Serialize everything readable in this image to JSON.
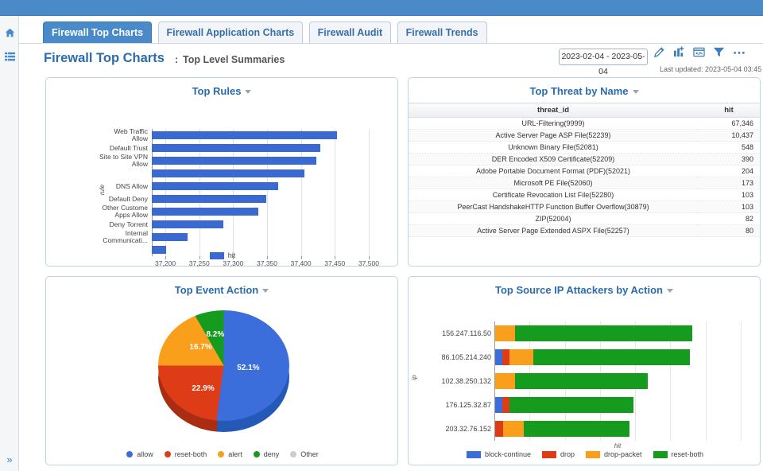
{
  "theme": {
    "band_blue": "#4a8ac9",
    "accent_blue": "#2b6cab",
    "bar_blue": "#3b69d4"
  },
  "rail": {
    "home_icon": "home-icon",
    "menu_icon": "list-menu-icon",
    "expand_icon": "double-chevron-right-icon"
  },
  "tabs": [
    {
      "label": "Firewall Top Charts",
      "active": true
    },
    {
      "label": "Firewall Application Charts",
      "active": false
    },
    {
      "label": "Firewall Audit",
      "active": false
    },
    {
      "label": "Firewall Trends",
      "active": false
    }
  ],
  "header": {
    "title": "Firewall Top Charts",
    "separator": ":",
    "subtitle": "Top Level Summaries",
    "date_range": "2023-02-04 - 2023-05-04",
    "last_updated": "Last updated: 2023-05-04 03:45",
    "refresh_icon": "refresh-icon",
    "tools": [
      {
        "name": "edit-pencil-icon",
        "label": "Edit"
      },
      {
        "name": "add-chart-icon",
        "label": "Add Chart"
      },
      {
        "name": "dashboard-widget-icon",
        "label": "Add Widget"
      },
      {
        "name": "filter-funnel-icon",
        "label": "Filter"
      },
      {
        "name": "more-options-icon",
        "label": "More"
      }
    ]
  },
  "panels": {
    "rules": {
      "title": "Top Rules",
      "caret": "chevron-down-icon"
    },
    "threat": {
      "title": "Top Threat by Name",
      "caret": "chevron-down-icon"
    },
    "event": {
      "title": "Top Event Action",
      "caret": "chevron-down-icon"
    },
    "source": {
      "title": "Top Source IP Attackers by Action",
      "caret": "chevron-down-icon"
    }
  },
  "threat_table": {
    "columns": [
      "threat_id",
      "hit"
    ],
    "rows": [
      [
        "URL-Filtering(9999)",
        "67,346"
      ],
      [
        "Active Server Page ASP File(52239)",
        "10,437"
      ],
      [
        "Unknown Binary File(52081)",
        "548"
      ],
      [
        "DER Encoded X509 Certificate(52209)",
        "390"
      ],
      [
        "Adobe Portable Document Format (PDF)(52021)",
        "204"
      ],
      [
        "Microsoft PE File(52060)",
        "173"
      ],
      [
        "Certificate Revocation List File(52280)",
        "103"
      ],
      [
        "PeerCast HandshakeHTTP Function Buffer Overflow(30879)",
        "103"
      ],
      [
        "ZIP(52004)",
        "82"
      ],
      [
        "Active Server Page Extended ASPX File(52257)",
        "80"
      ]
    ]
  },
  "chart_data": [
    {
      "id": "top_rules",
      "type": "bar",
      "orientation": "horizontal",
      "title": "Top Rules",
      "xlabel": "",
      "ylabel": "rule",
      "legend": [
        {
          "name": "hit",
          "color": "#3b69d4"
        }
      ],
      "legend_position": "bottom",
      "grid": true,
      "xlim": [
        37180,
        37520
      ],
      "xticks": [
        "37,200",
        "37,250",
        "37,300",
        "37,350",
        "37,400",
        "37,450",
        "37,500"
      ],
      "xtick_values": [
        37200,
        37250,
        37300,
        37350,
        37400,
        37450,
        37500
      ],
      "categories": [
        "Web Traffic Allow",
        "Default Trust",
        "Site to Site VPN Allow",
        "",
        "DNS Allow",
        "Default Deny",
        "Other Custome Apps Allow",
        "Deny Torrent",
        "Internal Communicati..."
      ],
      "values": [
        37453,
        37428,
        37423,
        37405,
        37366,
        37349,
        37337,
        37285,
        37233,
        37201
      ],
      "series": [
        {
          "name": "hit",
          "values": [
            37453,
            37428,
            37423,
            37405,
            37366,
            37349,
            37337,
            37285,
            37233,
            37201
          ]
        }
      ]
    },
    {
      "id": "top_event_action",
      "type": "pie",
      "title": "Top Event Action",
      "labels": [
        "allow",
        "reset-both",
        "alert",
        "deny",
        "Other"
      ],
      "values": [
        52.1,
        22.9,
        16.7,
        8.2,
        0
      ],
      "value_labels": [
        "52.1%",
        "22.9%",
        "16.7%",
        "8.2%",
        ""
      ],
      "colors": [
        "#3b6ddb",
        "#dd3c17",
        "#f99f1b",
        "#159b1e",
        "#cccccc"
      ],
      "legend_position": "bottom",
      "three_d": true
    },
    {
      "id": "top_source_ip_attackers",
      "type": "bar",
      "subtype": "stacked",
      "orientation": "horizontal",
      "title": "Top Source IP Attackers by Action",
      "xlabel": "hit",
      "ylabel": "ip",
      "grid": true,
      "xticks": [],
      "categories": [
        "156.247.116.50",
        "86.105.214.240",
        "102.38.250.132",
        "176.125.32.87",
        "203.32.76.152"
      ],
      "series": [
        {
          "name": "block-continue",
          "color": "#3b6ddb",
          "values": [
            0,
            6,
            0,
            6,
            0
          ]
        },
        {
          "name": "drop",
          "color": "#dd3c17",
          "values": [
            0,
            6,
            0,
            6,
            7
          ]
        },
        {
          "name": "drop-packet",
          "color": "#f99f1b",
          "values": [
            17,
            20,
            17,
            0,
            17
          ]
        },
        {
          "name": "reset-both",
          "color": "#159b1e",
          "values": [
            150,
            133,
            112,
            105,
            90
          ]
        }
      ],
      "legend_position": "bottom"
    }
  ]
}
